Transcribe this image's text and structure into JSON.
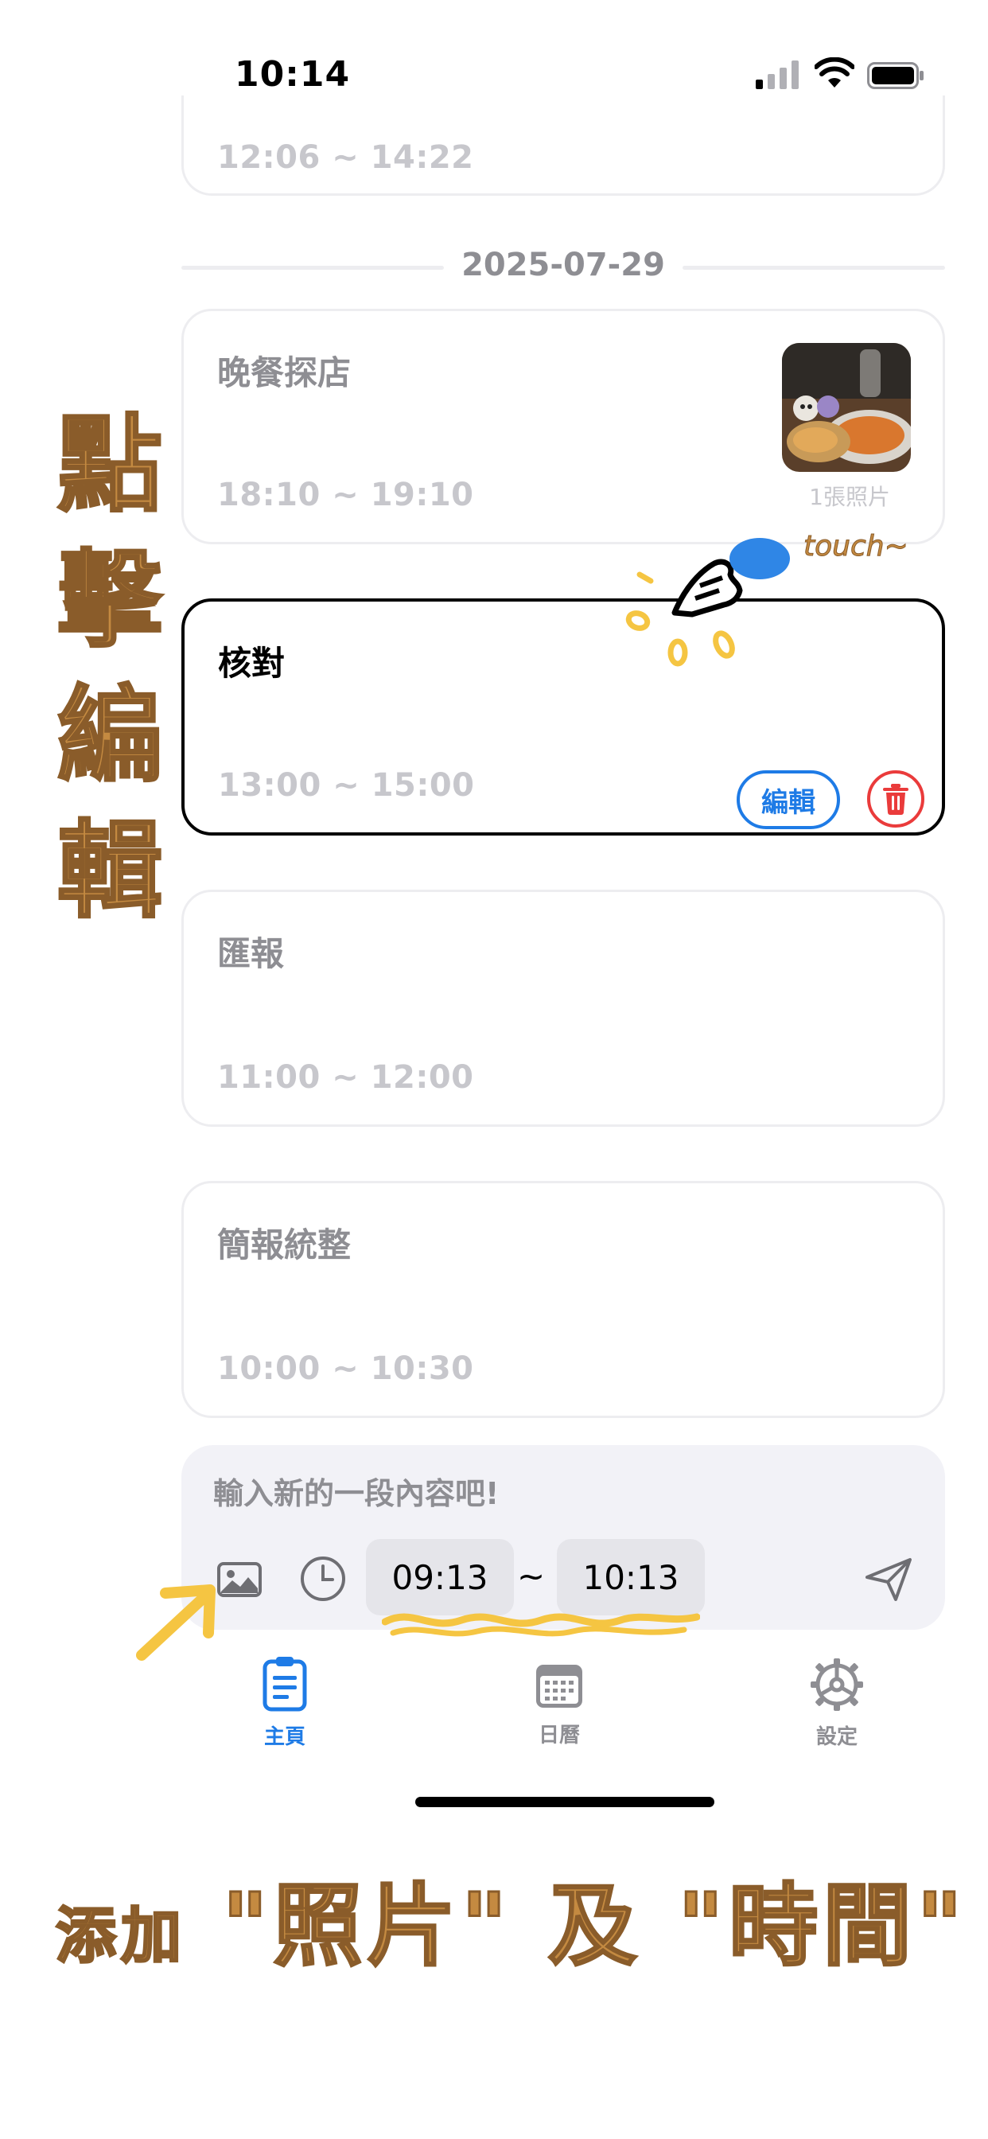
{
  "status_bar": {
    "time": "10:14"
  },
  "top_card": {
    "time": "12:06 ~ 14:22"
  },
  "date_separator": "2025-07-29",
  "events": [
    {
      "title": "晚餐探店",
      "time": "18:10 ~ 19:10",
      "photo_count": "1張照片"
    },
    {
      "title": "核對",
      "time": "13:00 ~ 15:00",
      "edit_label": "編輯"
    },
    {
      "title": "匯報",
      "time": "11:00 ~ 12:00"
    },
    {
      "title": "簡報統整",
      "time": "10:00 ~ 10:30"
    }
  ],
  "composer": {
    "placeholder": "輸入新的一段內容吧!",
    "start_time": "09:13",
    "separator": "~",
    "end_time": "10:13"
  },
  "tabs": [
    {
      "label": "主頁",
      "icon": "document-icon",
      "active": true
    },
    {
      "label": "日曆",
      "icon": "calendar-icon",
      "active": false
    },
    {
      "label": "設定",
      "icon": "gear-icon",
      "active": false
    }
  ],
  "annotations": {
    "tap_to_edit": "點擊編輯",
    "touch": "touch~",
    "add_prefix": "添加",
    "add_rest": "\"照片\" 及 \"時間\""
  },
  "colors": {
    "accent": "#1e7be6",
    "danger": "#ea3b3b",
    "annotation": "#c48a41",
    "highlight": "#f5c542"
  }
}
